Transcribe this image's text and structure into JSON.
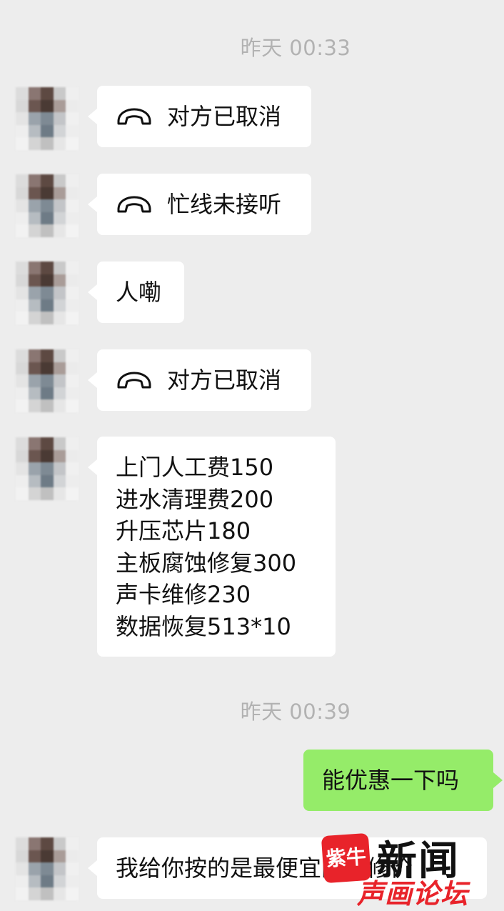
{
  "timestamps": [
    "昨天 00:33",
    "昨天 00:39"
  ],
  "messages": {
    "m1": {
      "icon": "hangup-phone-icon",
      "text": "对方已取消"
    },
    "m2": {
      "icon": "hangup-phone-icon",
      "text": "忙线未接听"
    },
    "m3": {
      "text": "人嘞"
    },
    "m4": {
      "icon": "hangup-phone-icon",
      "text": "对方已取消"
    },
    "m5": {
      "lines": [
        "上门人工费150",
        "进水清理费200",
        "升压芯片180",
        "主板腐蚀修复300",
        "声卡维修230",
        "数据恢复513*10"
      ]
    },
    "m6": {
      "text": "能优惠一下吗"
    },
    "m7": {
      "text": "我给你按的是最便宜的维修价"
    }
  },
  "watermark": {
    "logo": "紫牛",
    "title": "新闻",
    "subtitle": "声画论坛"
  },
  "colors": {
    "background": "#ededed",
    "bubble_in": "#ffffff",
    "bubble_out": "#95ec69",
    "timestamp": "#b2b2b2"
  }
}
